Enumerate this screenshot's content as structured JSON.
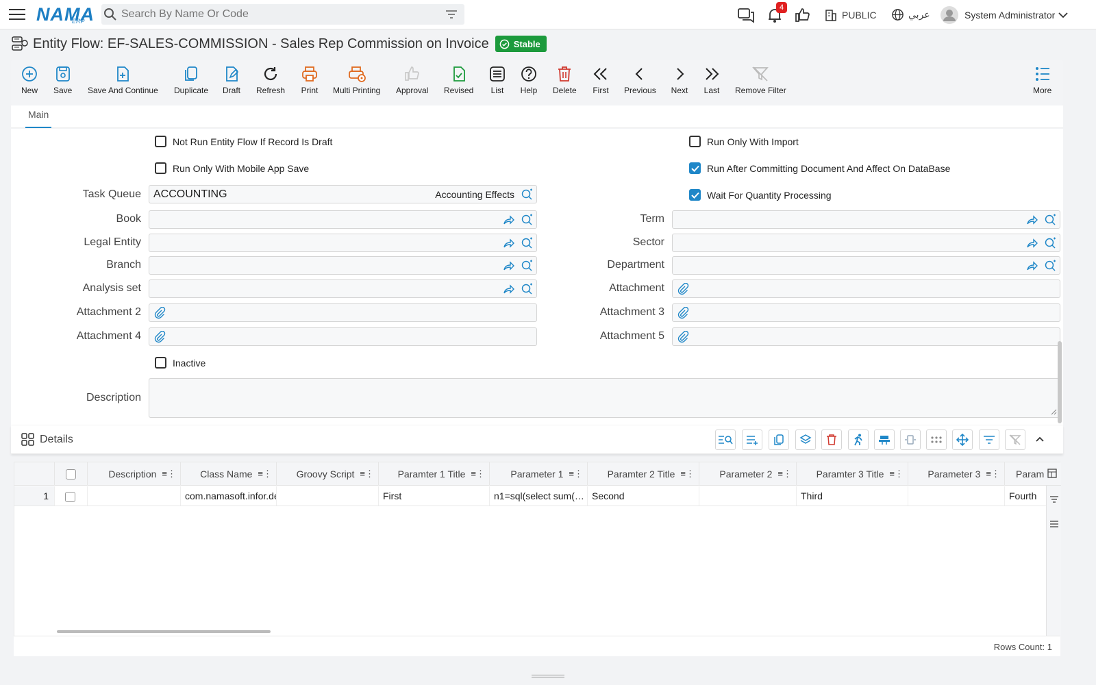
{
  "app": {
    "logo": "NAMA",
    "logo_sub": "ERP"
  },
  "search": {
    "placeholder": "Search By Name Or Code"
  },
  "topbar": {
    "notifications_count": "4",
    "public_label": "PUBLIC",
    "language_label": "عربي",
    "user_name": "System Administrator"
  },
  "page": {
    "title": "Entity Flow: EF-SALES-COMMISSION - Sales Rep Commission on Invoice",
    "status": "Stable"
  },
  "toolbar": {
    "new": "New",
    "save": "Save",
    "save_continue": "Save And Continue",
    "duplicate": "Duplicate",
    "draft": "Draft",
    "refresh": "Refresh",
    "print": "Print",
    "multi_printing": "Multi Printing",
    "approval": "Approval",
    "revised": "Revised",
    "list": "List",
    "help": "Help",
    "delete": "Delete",
    "first": "First",
    "previous": "Previous",
    "next": "Next",
    "last": "Last",
    "remove_filter": "Remove Filter",
    "more": "More"
  },
  "tabs": {
    "main": "Main"
  },
  "checks": {
    "not_run_draft": {
      "label": "Not Run Entity Flow If Record Is Draft",
      "checked": false
    },
    "run_only_mobile": {
      "label": "Run Only With Mobile App Save",
      "checked": false
    },
    "run_only_import": {
      "label": "Run Only With Import",
      "checked": false
    },
    "run_after_commit": {
      "label": "Run After Committing Document And Affect On DataBase",
      "checked": true
    },
    "wait_quantity": {
      "label": "Wait For Quantity Processing",
      "checked": true
    },
    "inactive": {
      "label": "Inactive",
      "checked": false
    }
  },
  "fields": {
    "task_queue": {
      "label": "Task Queue",
      "value": "ACCOUNTING",
      "sub": "Accounting Effects"
    },
    "book": {
      "label": "Book",
      "value": ""
    },
    "legal_entity": {
      "label": "Legal Entity",
      "value": ""
    },
    "branch": {
      "label": "Branch",
      "value": ""
    },
    "analysis_set": {
      "label": "Analysis set",
      "value": ""
    },
    "attachment2": {
      "label": "Attachment 2",
      "value": ""
    },
    "attachment4": {
      "label": "Attachment 4",
      "value": ""
    },
    "term": {
      "label": "Term",
      "value": ""
    },
    "sector": {
      "label": "Sector",
      "value": ""
    },
    "department": {
      "label": "Department",
      "value": ""
    },
    "attachment": {
      "label": "Attachment",
      "value": ""
    },
    "attachment3": {
      "label": "Attachment 3",
      "value": ""
    },
    "attachment5": {
      "label": "Attachment 5",
      "value": ""
    },
    "description": {
      "label": "Description",
      "value": ""
    }
  },
  "details": {
    "title": "Details",
    "columns": [
      "Description",
      "Class Name",
      "Groovy Script",
      "Paramter 1 Title",
      "Parameter 1",
      "Paramter 2 Title",
      "Parameter 2",
      "Paramter 3 Title",
      "Parameter 3",
      "Param"
    ],
    "rows": [
      {
        "num": "1",
        "cells": [
          "",
          "com.namasoft.infor.de",
          "",
          "First",
          "n1=sql(select sum(…",
          "Second",
          "",
          "Third",
          "",
          "Fourth"
        ]
      }
    ],
    "rows_count": "Rows Count: 1"
  }
}
